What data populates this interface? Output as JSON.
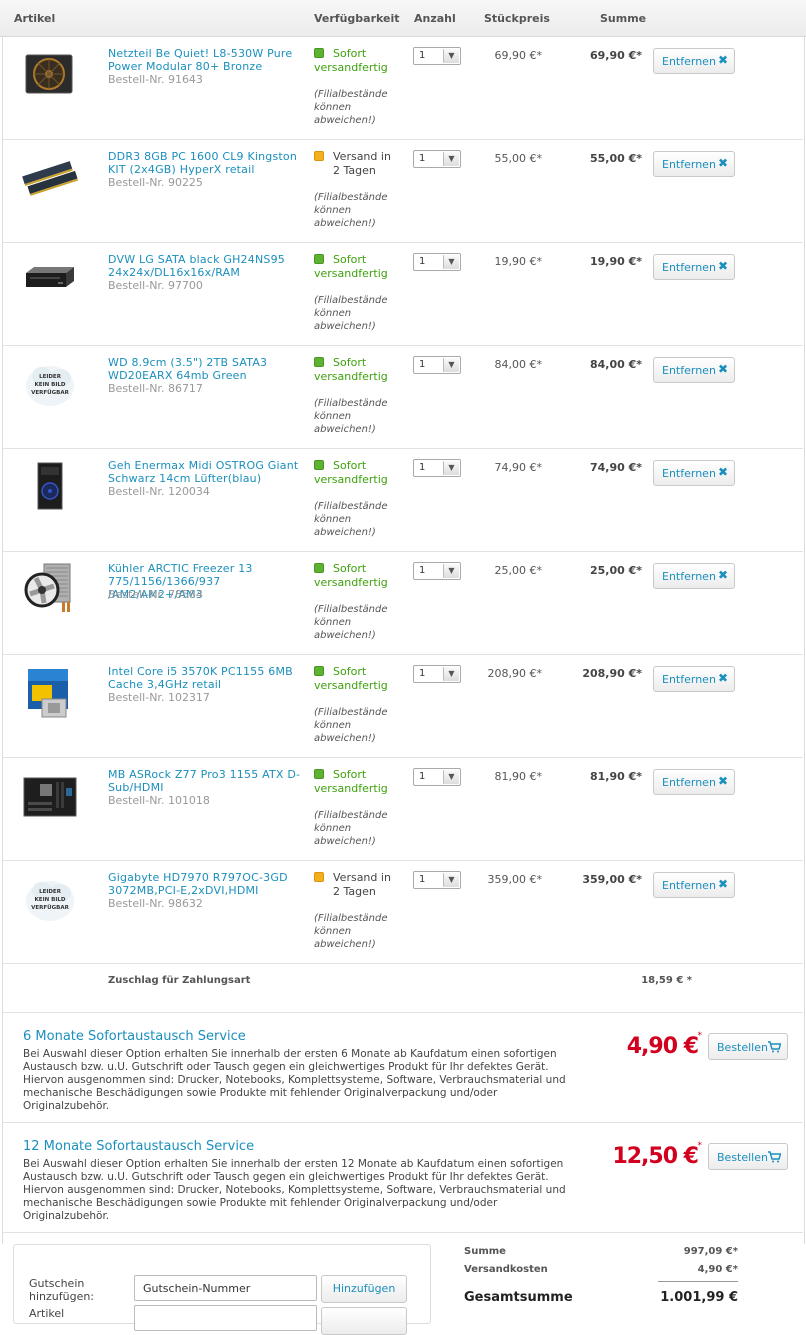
{
  "header": {
    "col_article": "Artikel",
    "col_availability": "Verfügbarkeit",
    "col_qty": "Anzahl",
    "col_unit_price": "Stückpreis",
    "col_sum": "Summe"
  },
  "colors": {
    "link": "#1a8fbd",
    "in_stock": "#3ea10d",
    "delayed": "#f2b01e",
    "price_red": "#d2001e"
  },
  "remove_label": "Entfernen",
  "branch_note": "(Filialbestände können abweichen!)",
  "items": [
    {
      "name": "Netzteil Be Quiet! L8-530W Pure Power Modular 80+ Bronze",
      "article_no": "Bestell-Nr. 91643",
      "availability": "Sofort versandfertig",
      "availability_status": "in-stock",
      "qty": "1",
      "unit_price": "69,90 €*",
      "sum": "69,90 €*",
      "icon": "power-supply-icon"
    },
    {
      "name": "DDR3 8GB PC 1600 CL9 Kingston KIT (2x4GB) HyperX retail",
      "article_no": "Bestell-Nr. 90225",
      "availability": "Versand in 2 Tagen",
      "availability_status": "delayed",
      "qty": "1",
      "unit_price": "55,00 €*",
      "sum": "55,00 €*",
      "icon": "ram-icon"
    },
    {
      "name": "DVW LG SATA black GH24NS95 24x24x/DL16x16x/RAM",
      "article_no": "Bestell-Nr. 97700",
      "availability": "Sofort versandfertig",
      "availability_status": "in-stock",
      "qty": "1",
      "unit_price": "19,90 €*",
      "sum": "19,90 €*",
      "icon": "dvd-drive-icon"
    },
    {
      "name": "WD 8.9cm (3.5\") 2TB SATA3 WD20EARX 64mb Green",
      "article_no": "Bestell-Nr. 86717",
      "availability": "Sofort versandfertig",
      "availability_status": "in-stock",
      "qty": "1",
      "unit_price": "84,00 €*",
      "sum": "84,00 €*",
      "icon": "no-image-icon"
    },
    {
      "name": "Geh Enermax Midi OSTROG Giant Schwarz 14cm Lüfter(blau)",
      "article_no": "Bestell-Nr. 120034",
      "availability": "Sofort versandfertig",
      "availability_status": "in-stock",
      "qty": "1",
      "unit_price": "74,90 €*",
      "sum": "74,90 €*",
      "icon": "pc-case-icon"
    },
    {
      "name": "Kühler ARCTIC Freezer 13 775/1156/1366/937 /AM2/AM2+/AM3",
      "article_no": "Bestell-Nr. 78584",
      "availability": "Sofort versandfertig",
      "availability_status": "in-stock",
      "qty": "1",
      "unit_price": "25,00 €*",
      "sum": "25,00 €*",
      "icon": "cpu-cooler-icon"
    },
    {
      "name": "Intel Core i5 3570K PC1155 6MB Cache 3,4GHz retail",
      "article_no": "Bestell-Nr. 102317",
      "availability": "Sofort versandfertig",
      "availability_status": "in-stock",
      "qty": "1",
      "unit_price": "208,90 €*",
      "sum": "208,90 €*",
      "icon": "cpu-box-icon"
    },
    {
      "name": "MB ASRock Z77 Pro3 1155 ATX D-Sub/HDMI",
      "article_no": "Bestell-Nr. 101018",
      "availability": "Sofort versandfertig",
      "availability_status": "in-stock",
      "qty": "1",
      "unit_price": "81,90 €*",
      "sum": "81,90 €*",
      "icon": "motherboard-icon"
    },
    {
      "name": "Gigabyte HD7970 R797OC-3GD 3072MB,PCI-E,2xDVI,HDMI",
      "article_no": "Bestell-Nr. 98632",
      "availability": "Versand in 2 Tagen",
      "availability_status": "delayed",
      "qty": "1",
      "unit_price": "359,00 €*",
      "sum": "359,00 €*",
      "icon": "no-image-icon"
    }
  ],
  "no_image_text": "LEIDER KEIN BILD VERFÜGBAR",
  "surcharge": {
    "label": "Zuschlag für Zahlungsart",
    "value": "18,59 € *"
  },
  "services": [
    {
      "title": "6 Monate Sofortaustausch Service",
      "description": "Bei Auswahl dieser Option erhalten Sie innerhalb der ersten 6 Monate ab Kaufdatum einen sofortigen Austausch bzw. u.U. Gutschrift oder Tausch gegen ein gleichwertiges Produkt für Ihr defektes Gerät. Hiervon ausgenommen sind: Drucker, Notebooks, Komplettsysteme, Software, Verbrauchsmaterial und mechanische Beschädigungen sowie Produkte mit fehlender Originalverpackung und/oder Originalzubehör.",
      "price": "4,90 €",
      "star": "*",
      "button": "Bestellen"
    },
    {
      "title": "12 Monate Sofortaustausch Service",
      "description": "Bei Auswahl dieser Option erhalten Sie innerhalb der ersten 12 Monate ab Kaufdatum einen sofortigen Austausch bzw. u.U. Gutschrift oder Tausch gegen ein gleichwertiges Produkt für Ihr defektes Gerät. Hiervon ausgenommen sind: Drucker, Notebooks, Komplettsysteme, Software, Verbrauchsmaterial und mechanische Beschädigungen sowie Produkte mit fehlender Originalverpackung und/oder Originalzubehör.",
      "price": "12,50 €",
      "star": "*",
      "button": "Bestellen"
    }
  ],
  "coupon": {
    "label": "Gutschein hinzufügen:",
    "input_value": "Gutschein-Nummer",
    "button": "Hinzufügen",
    "label2": "Artikel"
  },
  "totals": {
    "subtotal_label": "Summe",
    "subtotal_value": "997,09 €*",
    "shipping_label": "Versandkosten",
    "shipping_value": "4,90 €*",
    "total_label": "Gesamtsumme",
    "total_value": "1.001,99 €"
  }
}
